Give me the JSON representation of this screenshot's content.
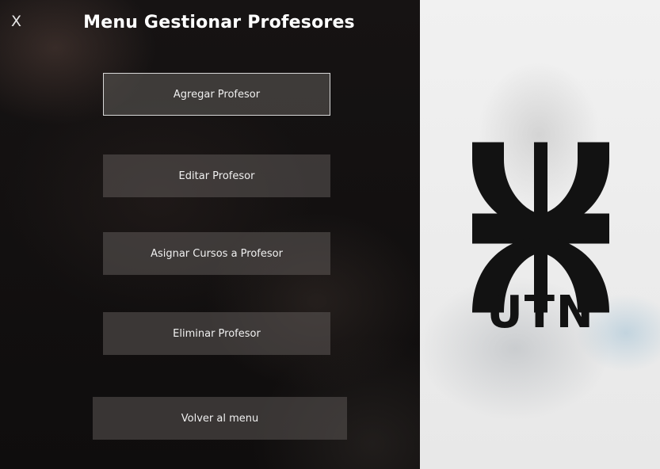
{
  "window": {
    "close_label": "X",
    "title": "Menu Gestionar Profesores"
  },
  "menu": {
    "agregar": "Agregar Profesor",
    "editar": "Editar Profesor",
    "asignar": "Asignar Cursos a Profesor",
    "eliminar": "Eliminar Profesor",
    "volver": "Volver al menu"
  },
  "logo": {
    "text": "UTN"
  },
  "colors": {
    "panel_dark": "#121010",
    "panel_light": "#eeeeee",
    "logo": "#121212",
    "text": "#ffffff"
  }
}
